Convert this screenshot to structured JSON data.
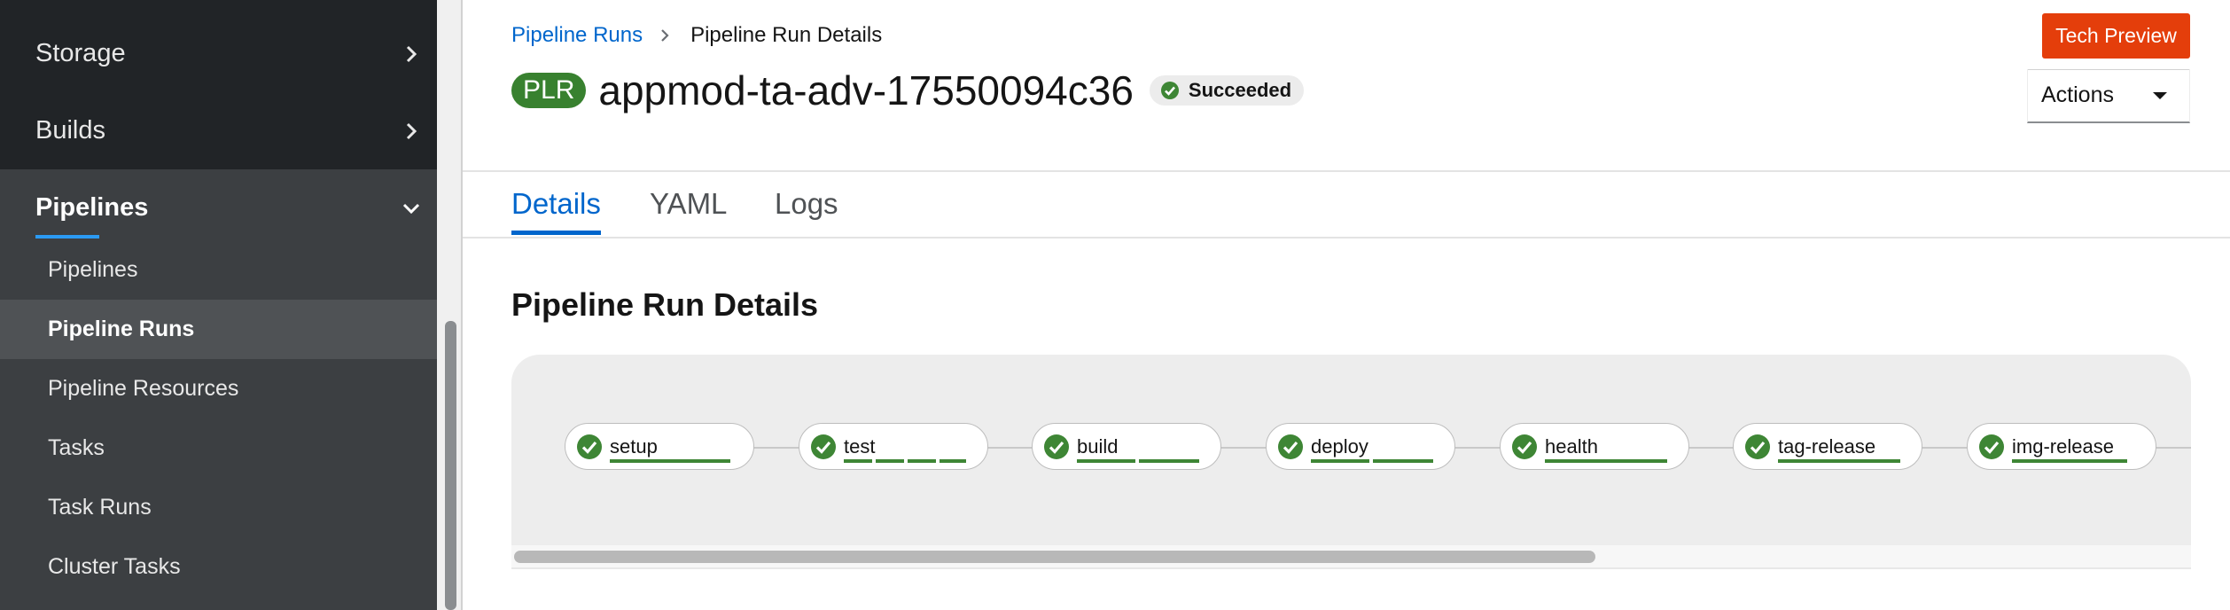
{
  "sidebar": {
    "groups": [
      {
        "label": "Storage"
      },
      {
        "label": "Builds"
      },
      {
        "label": "Pipelines"
      }
    ],
    "pipelines_items": [
      {
        "label": "Pipelines"
      },
      {
        "label": "Pipeline Runs"
      },
      {
        "label": "Pipeline Resources"
      },
      {
        "label": "Tasks"
      },
      {
        "label": "Task Runs"
      },
      {
        "label": "Cluster Tasks"
      }
    ],
    "current_item": "Pipeline Runs"
  },
  "breadcrumb": {
    "parent": "Pipeline Runs",
    "current": "Pipeline Run Details"
  },
  "tech_preview_label": "Tech Preview",
  "header": {
    "badge": "PLR",
    "title": "appmod-ta-adv-17550094c36",
    "status": "Succeeded"
  },
  "actions_label": "Actions",
  "tabs": [
    {
      "label": "Details"
    },
    {
      "label": "YAML"
    },
    {
      "label": "Logs"
    }
  ],
  "active_tab": "Details",
  "section_title": "Pipeline Run Details",
  "tasks": [
    {
      "name": "setup",
      "status": "succeeded"
    },
    {
      "name": "test",
      "status": "succeeded"
    },
    {
      "name": "build",
      "status": "succeeded"
    },
    {
      "name": "deploy",
      "status": "succeeded"
    },
    {
      "name": "health",
      "status": "succeeded"
    },
    {
      "name": "tag-release",
      "status": "succeeded"
    },
    {
      "name": "img-release",
      "status": "succeeded"
    }
  ],
  "colors": {
    "sidebar_bg": "#212427",
    "link": "#0066cc",
    "success": "#3e8635",
    "tech_preview": "#e43e0b"
  }
}
